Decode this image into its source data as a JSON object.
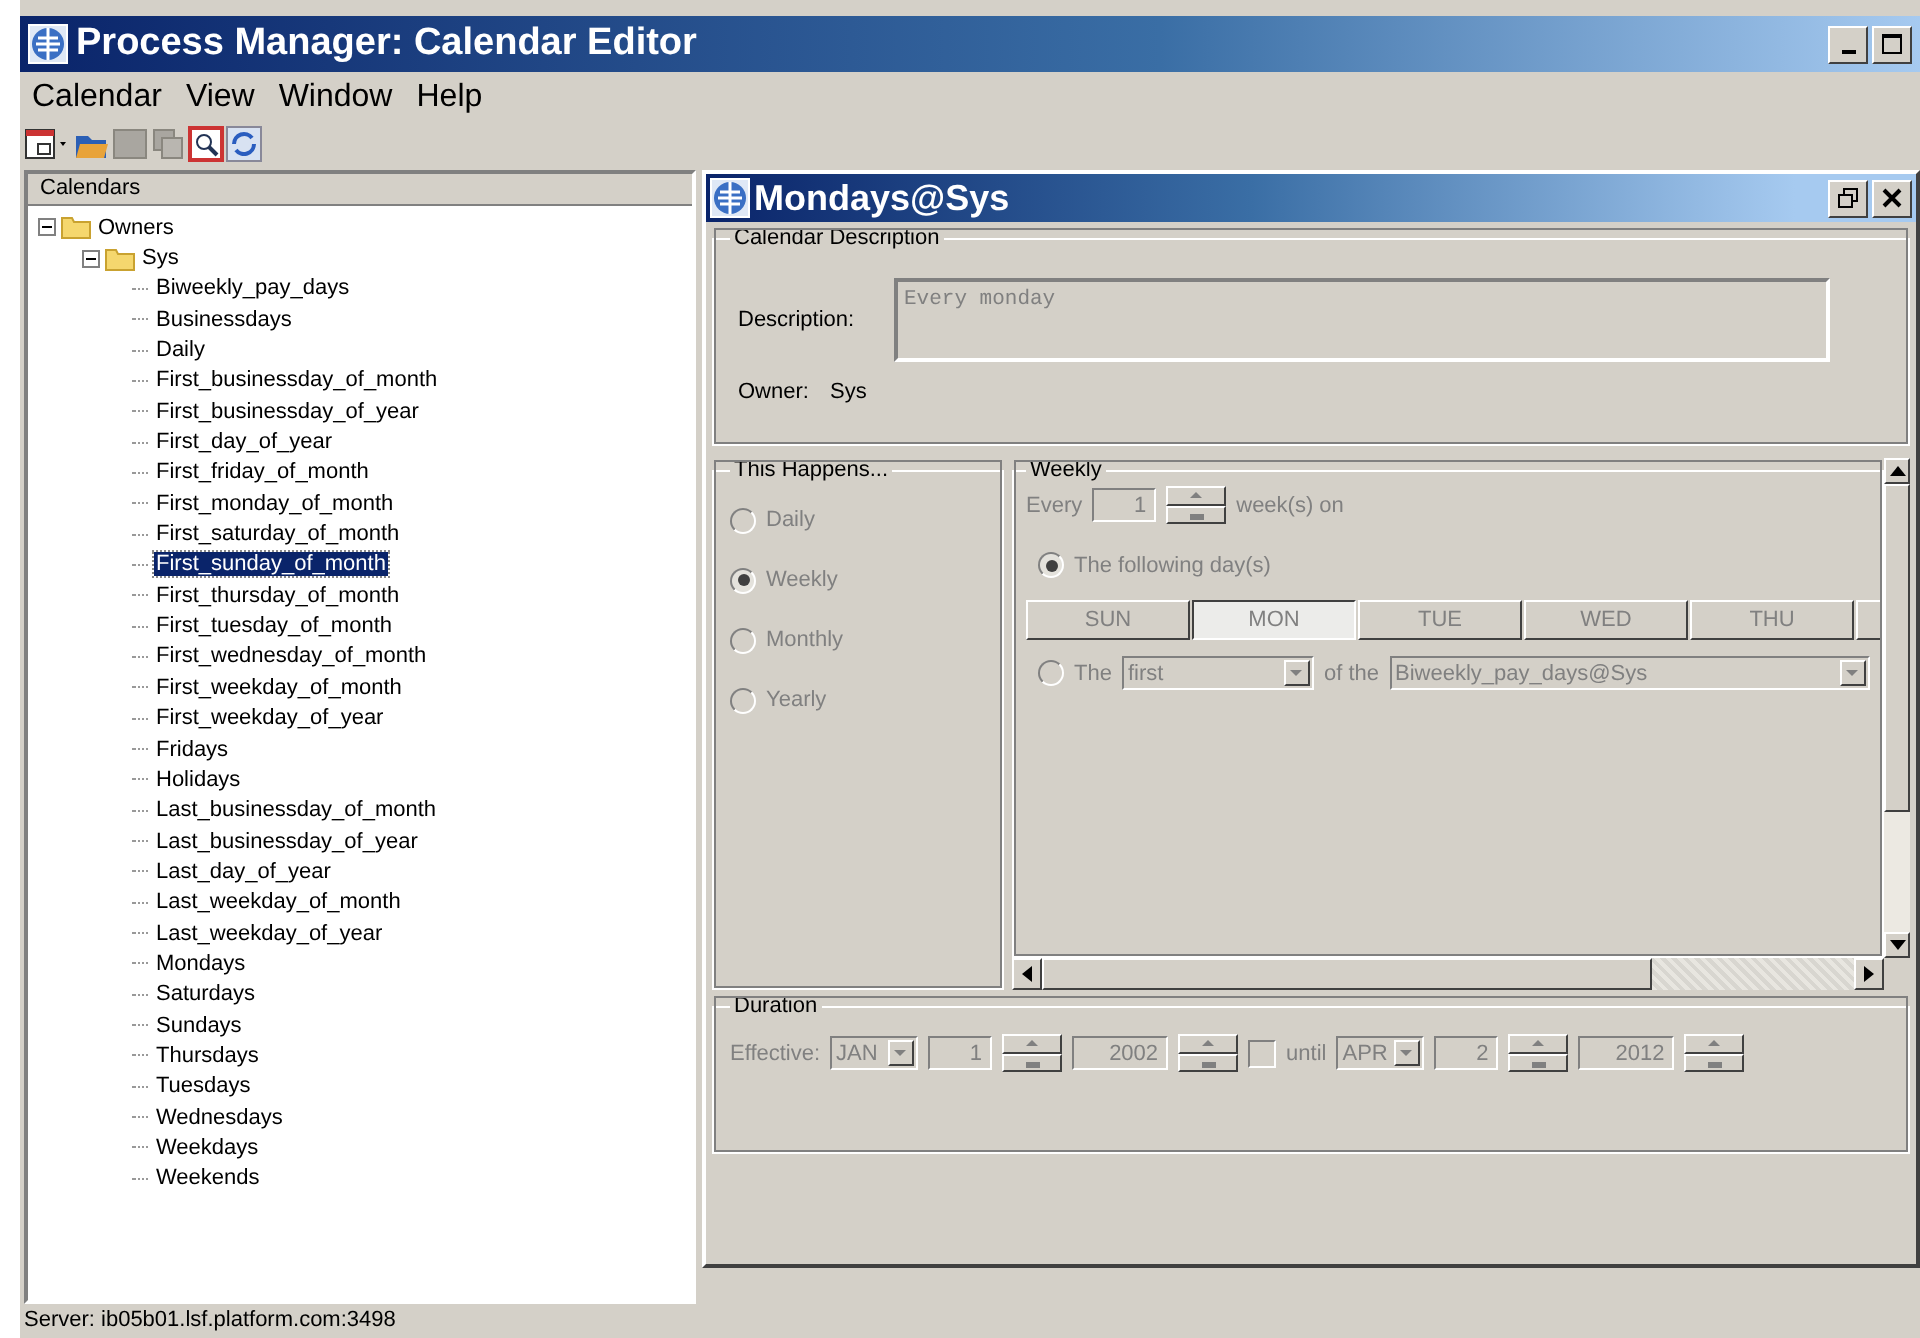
{
  "window": {
    "title": "Process Manager: Calendar Editor"
  },
  "menu": [
    "Calendar",
    "View",
    "Window",
    "Help"
  ],
  "calendars_panel": {
    "title": "Calendars",
    "tree": [
      {
        "label": "Owners",
        "expanded": true,
        "children": [
          {
            "label": "Sys",
            "expanded": true,
            "children": [
              {
                "label": "Biweekly_pay_days",
                "selected": false
              },
              {
                "label": "Businessdays",
                "selected": false
              },
              {
                "label": "Daily",
                "selected": false
              },
              {
                "label": "First_businessday_of_month",
                "selected": false
              },
              {
                "label": "First_businessday_of_year",
                "selected": false
              },
              {
                "label": "First_day_of_year",
                "selected": false
              },
              {
                "label": "First_friday_of_month",
                "selected": false
              },
              {
                "label": "First_monday_of_month",
                "selected": false
              },
              {
                "label": "First_saturday_of_month",
                "selected": false
              },
              {
                "label": "First_sunday_of_month",
                "selected": true
              },
              {
                "label": "First_thursday_of_month",
                "selected": false
              },
              {
                "label": "First_tuesday_of_month",
                "selected": false
              },
              {
                "label": "First_wednesday_of_month",
                "selected": false
              },
              {
                "label": "First_weekday_of_month",
                "selected": false
              },
              {
                "label": "First_weekday_of_year",
                "selected": false
              },
              {
                "label": "Fridays",
                "selected": false
              },
              {
                "label": "Holidays",
                "selected": false
              },
              {
                "label": "Last_businessday_of_month",
                "selected": false
              },
              {
                "label": "Last_businessday_of_year",
                "selected": false
              },
              {
                "label": "Last_day_of_year",
                "selected": false
              },
              {
                "label": "Last_weekday_of_month",
                "selected": false
              },
              {
                "label": "Last_weekday_of_year",
                "selected": false
              },
              {
                "label": "Mondays",
                "selected": false
              },
              {
                "label": "Saturdays",
                "selected": false
              },
              {
                "label": "Sundays",
                "selected": false
              },
              {
                "label": "Thursdays",
                "selected": false
              },
              {
                "label": "Tuesdays",
                "selected": false
              },
              {
                "label": "Wednesdays",
                "selected": false
              },
              {
                "label": "Weekdays",
                "selected": false
              },
              {
                "label": "Weekends",
                "selected": false
              }
            ]
          }
        ]
      }
    ]
  },
  "editor": {
    "title": "Mondays@Sys",
    "description_group": {
      "title": "Calendar Description",
      "description_label": "Description:",
      "description": "Every monday",
      "owner_label": "Owner:",
      "owner": "Sys"
    },
    "happens": {
      "title": "This Happens...",
      "options": [
        {
          "label": "Daily",
          "selected": false
        },
        {
          "label": "Weekly",
          "selected": true
        },
        {
          "label": "Monthly",
          "selected": false
        },
        {
          "label": "Yearly",
          "selected": false
        }
      ]
    },
    "weekly": {
      "title": "Weekly",
      "every_label": "Every",
      "every_value": "1",
      "weeks_label": "week(s) on",
      "following": {
        "label": "The following day(s)",
        "selected": true
      },
      "days": [
        {
          "label": "SUN",
          "selected": false
        },
        {
          "label": "MON",
          "selected": true
        },
        {
          "label": "TUE",
          "selected": false
        },
        {
          "label": "WED",
          "selected": false
        },
        {
          "label": "THU",
          "selected": false
        }
      ],
      "the_option": {
        "label": "The",
        "selected": false
      },
      "ordinal": "first",
      "of_the": "of the",
      "calendar": "Biweekly_pay_days@Sys"
    },
    "duration": {
      "title": "Duration",
      "effective_label": "Effective:",
      "start_month": "JAN",
      "start_day": "1",
      "start_year": "2002",
      "until": {
        "label": "until",
        "checked": false
      },
      "end_month": "APR",
      "end_day": "2",
      "end_year": "2012"
    }
  },
  "status_bar": "Server: ib05b01.lsf.platform.com:3498"
}
